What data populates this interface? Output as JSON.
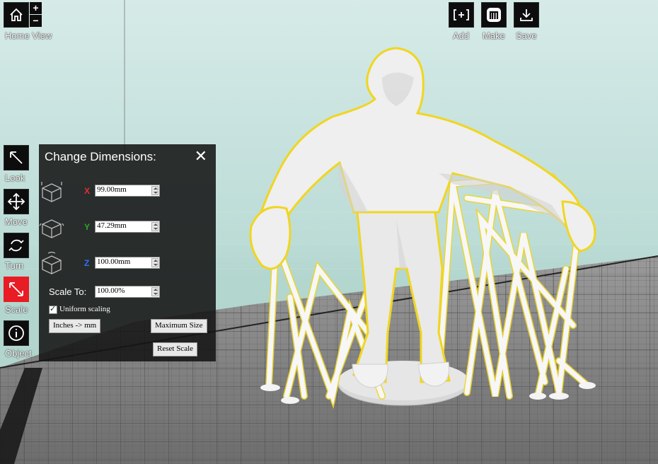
{
  "toolbar": {
    "home_view_label": "Home View",
    "zoom_in": "+",
    "zoom_out": "−",
    "add_label": "Add",
    "make_label": "Make",
    "save_label": "Save"
  },
  "tools": [
    {
      "label": "Look",
      "icon": "look-icon"
    },
    {
      "label": "Move",
      "icon": "move-icon"
    },
    {
      "label": "Turn",
      "icon": "turn-icon"
    },
    {
      "label": "Scale",
      "icon": "scale-icon",
      "active": true
    },
    {
      "label": "Object",
      "icon": "info-icon"
    }
  ],
  "panel": {
    "title": "Change Dimensions:",
    "close": "✕",
    "x_axis": "X",
    "y_axis": "Y",
    "z_axis": "Z",
    "x_value": "99.00mm",
    "y_value": "47.29mm",
    "z_value": "100.00mm",
    "scale_label": "Scale To:",
    "scale_value": "100.00%",
    "uniform_label": "Uniform scaling",
    "uniform_checked": true,
    "inches_button": "Inches -> mm",
    "max_size_button": "Maximum Size",
    "reset_button": "Reset Scale"
  },
  "colors": {
    "active_tool": "#e81c24",
    "toolbar_bg": "#0d0d0d",
    "x_axis": "#e03030",
    "y_axis": "#2aa82a",
    "z_axis": "#2f6fff",
    "highlight": "#f2d21a",
    "model": "#f4f4f4"
  }
}
